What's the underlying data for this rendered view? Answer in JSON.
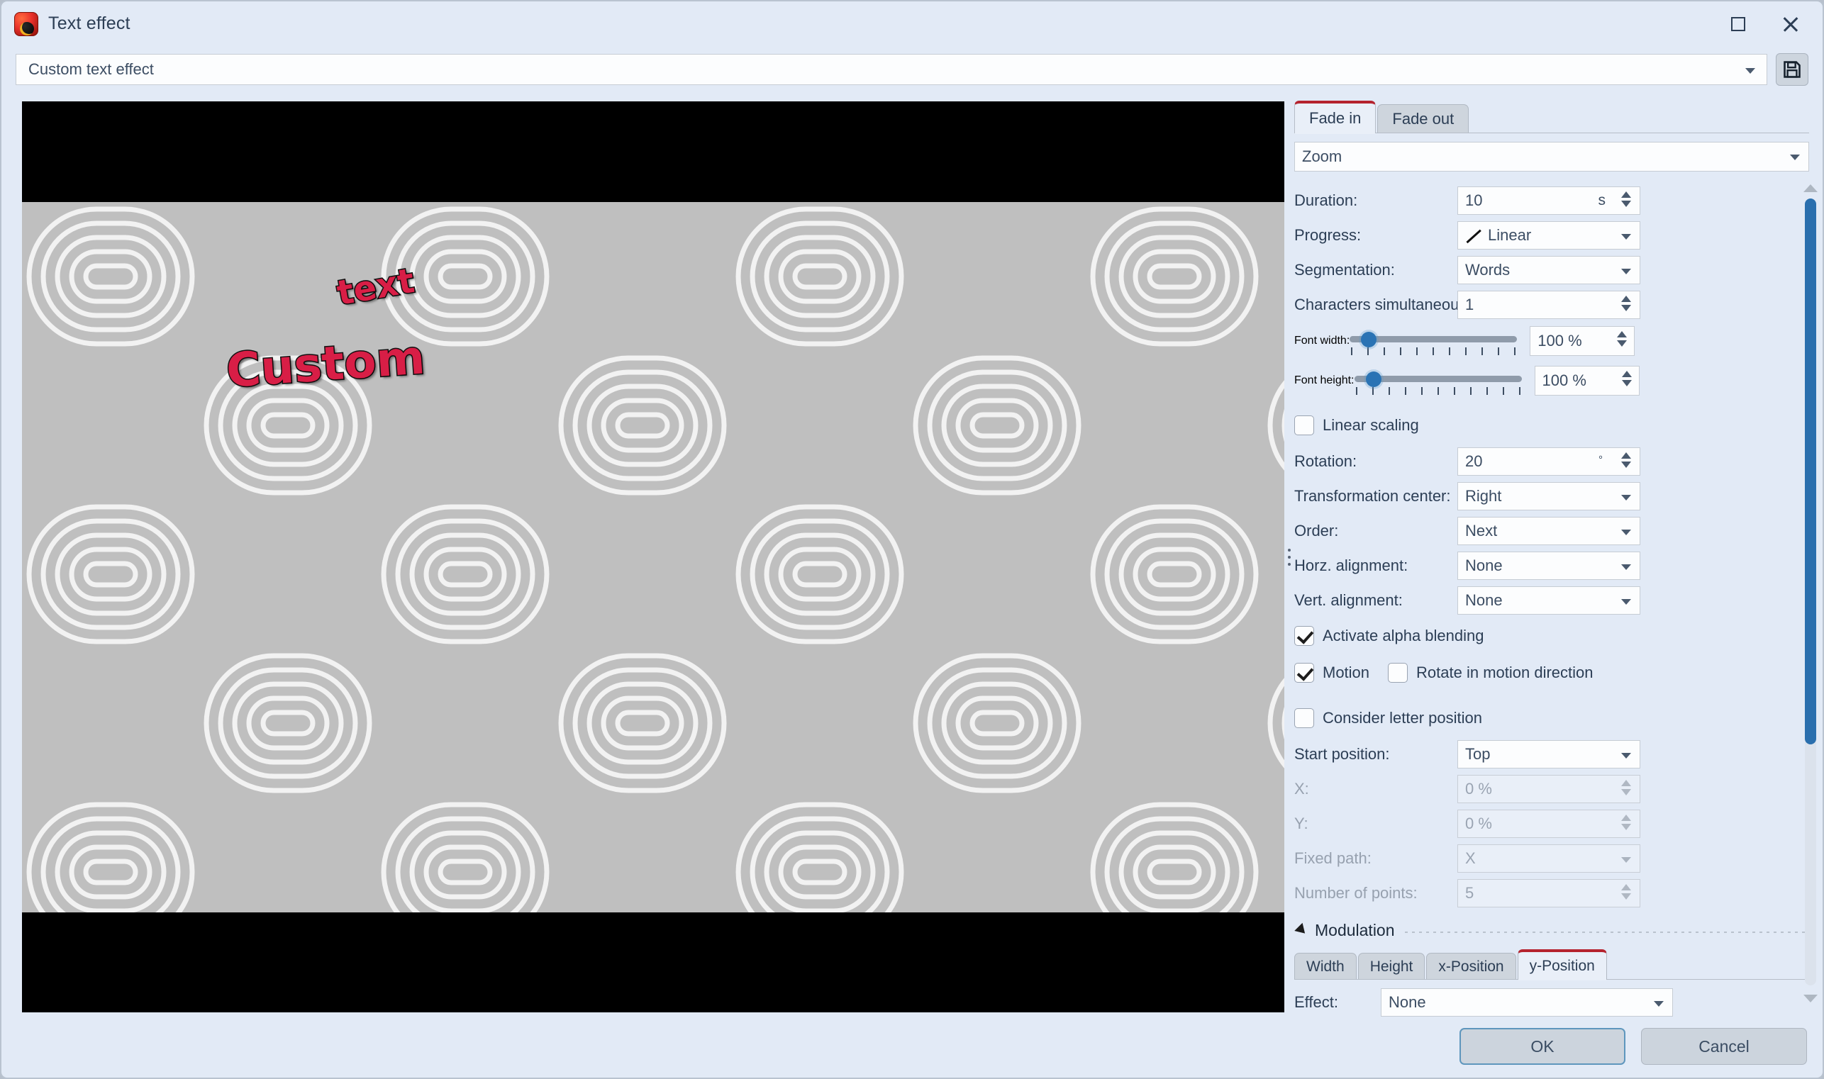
{
  "window": {
    "title": "Text effect",
    "icon": "app-logo-icon",
    "controls": {
      "maximize": "maximize-icon",
      "close": "close-icon"
    }
  },
  "preset": {
    "value": "Custom text effect",
    "placeholder": "Custom text effect",
    "save_icon": "floppy-save-icon"
  },
  "preview": {
    "texts": [
      {
        "label": "Custom"
      },
      {
        "label": "text"
      }
    ],
    "text_color": "#d81e46",
    "background_color": "#bfbfbf",
    "letterbox_color": "#000000"
  },
  "tabs": {
    "items": [
      {
        "label": "Fade in",
        "active": true
      },
      {
        "label": "Fade out",
        "active": false
      }
    ],
    "active_accent": "#b5232e"
  },
  "effect": {
    "value": "Zoom"
  },
  "fields": {
    "duration": {
      "label": "Duration:",
      "value": "10",
      "unit": "s"
    },
    "progress": {
      "label": "Progress:",
      "value": "Linear",
      "icon": "linear-curve-icon"
    },
    "segmentation": {
      "label": "Segmentation:",
      "value": "Words"
    },
    "characters_simultaneously": {
      "label": "Characters simultaneously:",
      "value": "1"
    },
    "font_width": {
      "label": "Font width:",
      "value": "100 %",
      "slider_percent": 8,
      "ticks": 11
    },
    "font_height": {
      "label": "Font height:",
      "value": "100 %",
      "slider_percent": 8,
      "ticks": 11
    },
    "linear_scaling": {
      "label": "Linear scaling",
      "checked": false
    },
    "rotation": {
      "label": "Rotation:",
      "value": "20",
      "unit": "°"
    },
    "transformation_center": {
      "label": "Transformation center:",
      "value": "Right"
    },
    "order": {
      "label": "Order:",
      "value": "Next"
    },
    "horz_alignment": {
      "label": "Horz. alignment:",
      "value": "None"
    },
    "vert_alignment": {
      "label": "Vert. alignment:",
      "value": "None"
    },
    "activate_alpha_blending": {
      "label": "Activate alpha blending",
      "checked": true
    },
    "motion": {
      "label": "Motion",
      "checked": true
    },
    "rotate_in_motion_direction": {
      "label": "Rotate in motion direction",
      "checked": false
    },
    "consider_letter_position": {
      "label": "Consider letter position",
      "checked": false
    },
    "start_position": {
      "label": "Start position:",
      "value": "Top"
    },
    "x": {
      "label": "X:",
      "value": "0 %",
      "disabled": true
    },
    "y": {
      "label": "Y:",
      "value": "0 %",
      "disabled": true
    },
    "fixed_path": {
      "label": "Fixed path:",
      "value": "X",
      "disabled": true
    },
    "number_of_points": {
      "label": "Number of points:",
      "value": "5",
      "disabled": true
    }
  },
  "modulation": {
    "title": "Modulation",
    "collapse_icon": "triangle-collapse-icon",
    "tabs": [
      {
        "label": "Width",
        "active": false
      },
      {
        "label": "Height",
        "active": false
      },
      {
        "label": "x-Position",
        "active": false
      },
      {
        "label": "y-Position",
        "active": true
      }
    ],
    "effect": {
      "label": "Effect:",
      "value": "None"
    }
  },
  "scrollbar": {
    "name": "vertical-scrollbar",
    "thumb_color": "#2a6fae"
  },
  "footer": {
    "ok": "OK",
    "cancel": "Cancel"
  }
}
